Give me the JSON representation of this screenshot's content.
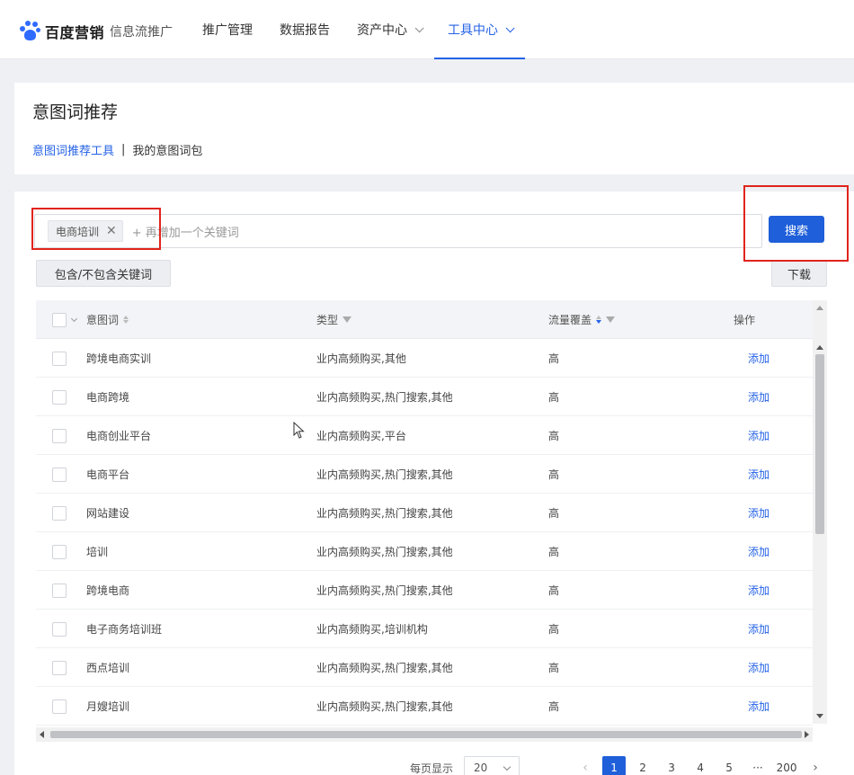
{
  "brand": {
    "name": "百度营销",
    "product": "信息流推广",
    "accent": "#2462e6"
  },
  "nav": {
    "items": [
      {
        "label": "推广管理",
        "has_dropdown": false,
        "active": false
      },
      {
        "label": "数据报告",
        "has_dropdown": false,
        "active": false
      },
      {
        "label": "资产中心",
        "has_dropdown": true,
        "active": false
      },
      {
        "label": "工具中心",
        "has_dropdown": true,
        "active": true
      }
    ]
  },
  "page": {
    "title": "意图词推荐",
    "subnav": {
      "active": "意图词推荐工具",
      "separator": "|",
      "other": "我的意图词包"
    }
  },
  "search": {
    "tags": [
      {
        "label": "电商培训",
        "remove_icon": "close-icon"
      }
    ],
    "placeholder": "+ 再增加一个关键词",
    "button_label": "搜索"
  },
  "toolbar": {
    "filter_label": "包含/不包含关键词",
    "download_label": "下载"
  },
  "table": {
    "columns": {
      "keyword": "意图词",
      "type": "类型",
      "traffic": "流量覆盖",
      "action": "操作"
    },
    "rows": [
      {
        "keyword": "跨境电商实训",
        "type": "业内高频购买,其他",
        "traffic": "高",
        "action": "添加"
      },
      {
        "keyword": "电商跨境",
        "type": "业内高频购买,热门搜索,其他",
        "traffic": "高",
        "action": "添加"
      },
      {
        "keyword": "电商创业平台",
        "type": "业内高频购买,平台",
        "traffic": "高",
        "action": "添加"
      },
      {
        "keyword": "电商平台",
        "type": "业内高频购买,热门搜索,其他",
        "traffic": "高",
        "action": "添加"
      },
      {
        "keyword": "网站建设",
        "type": "业内高频购买,热门搜索,其他",
        "traffic": "高",
        "action": "添加"
      },
      {
        "keyword": "培训",
        "type": "业内高频购买,热门搜索,其他",
        "traffic": "高",
        "action": "添加"
      },
      {
        "keyword": "跨境电商",
        "type": "业内高频购买,热门搜索,其他",
        "traffic": "高",
        "action": "添加"
      },
      {
        "keyword": "电子商务培训班",
        "type": "业内高频购买,培训机构",
        "traffic": "高",
        "action": "添加"
      },
      {
        "keyword": "西点培训",
        "type": "业内高频购买,热门搜索,其他",
        "traffic": "高",
        "action": "添加"
      },
      {
        "keyword": "月嫂培训",
        "type": "业内高频购买,热门搜索,其他",
        "traffic": "高",
        "action": "添加"
      }
    ]
  },
  "pagination": {
    "page_size_label": "每页显示",
    "page_size": "20",
    "prev": "‹",
    "pages": [
      "1",
      "2",
      "3",
      "4",
      "5"
    ],
    "ellipsis": "···",
    "last_page": "200",
    "next": "›",
    "current": "1"
  }
}
